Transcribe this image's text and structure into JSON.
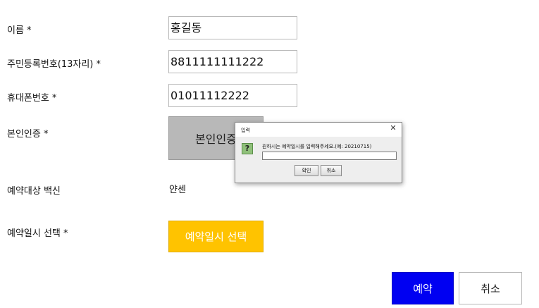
{
  "form": {
    "name_label": "이름 *",
    "name_value": "홍길동",
    "rrn_label": "주민등록번호(13자리) *",
    "rrn_value": "8811111111222",
    "phone_label": "휴대폰번호 *",
    "phone_value": "01011112222",
    "verify_label": "본인인증 *",
    "verify_button": "본인인증",
    "vaccine_label": "예약대상 백신",
    "vaccine_value": "얀센",
    "date_label": "예약일시 선택 *",
    "date_button": "예약일시 선택",
    "reserve_button": "예약",
    "cancel_button": "취소"
  },
  "dialog": {
    "title": "입력",
    "close_glyph": "✕",
    "icon_glyph": "?",
    "message": "원하시는 예약일시를 입력해주세요.(예: 20210715)",
    "input_value": "",
    "ok_button": "확인",
    "cancel_button": "취소"
  },
  "colors": {
    "reserve_button_bg": "#0000f2",
    "date_button_bg": "#ffc300",
    "verify_button_bg": "#b8b8b8"
  }
}
